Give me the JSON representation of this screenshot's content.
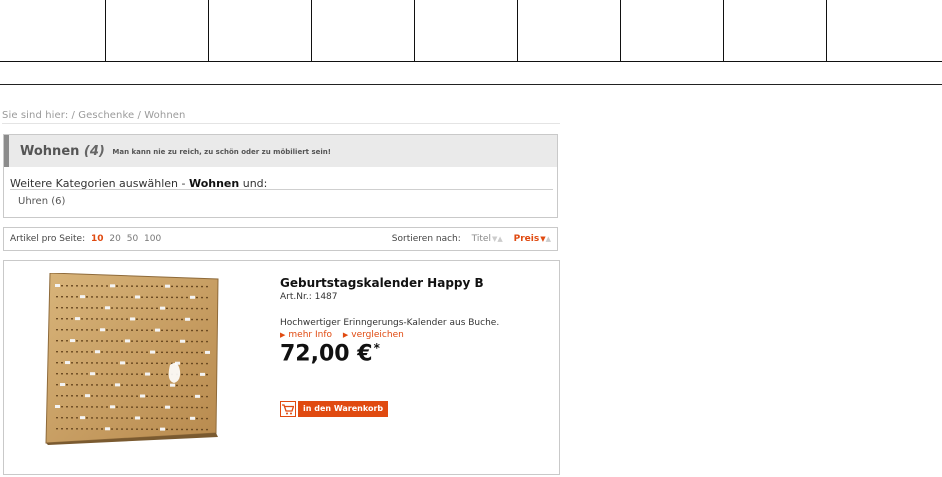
{
  "breadcrumb": {
    "text": "Sie sind hier: / Geschenke / Wohnen"
  },
  "category": {
    "title": "Wohnen",
    "count": "(4)",
    "slogan": "Man kann nie zu reich, zu schön oder zu möbiliert sein!",
    "choose_prefix": "Weitere Kategorien auswählen - ",
    "choose_bold": "Wohnen",
    "choose_suffix": " und:",
    "subcategories": [
      {
        "label": "Uhren (6)"
      }
    ]
  },
  "paging": {
    "label": "Artikel pro Seite:",
    "options": [
      {
        "label": "10",
        "active": true
      },
      {
        "label": "20",
        "active": false
      },
      {
        "label": "50",
        "active": false
      },
      {
        "label": "100",
        "active": false
      }
    ],
    "sort_label": "Sortieren nach:",
    "sort_options": [
      {
        "label": "Titel",
        "active": false
      },
      {
        "label": "Preis",
        "active": true
      }
    ]
  },
  "product": {
    "title": "Geburtstagskalender Happy B",
    "art_nr": "Art.Nr.: 1487",
    "description": "Hochwertiger Erinngerungs-Kalender aus Buche.",
    "links": [
      {
        "label": "mehr Info"
      },
      {
        "label": "vergleichen"
      }
    ],
    "price": "72,00 €",
    "price_note": "*",
    "cart_label": "in den Warenkorb",
    "cart_icon": "shopping-cart-icon",
    "image_icon": "wooden-peg-board-calendar"
  },
  "colors": {
    "accent": "#e04a10",
    "header_bg": "#eaeaea",
    "border": "#c9c9c9"
  }
}
